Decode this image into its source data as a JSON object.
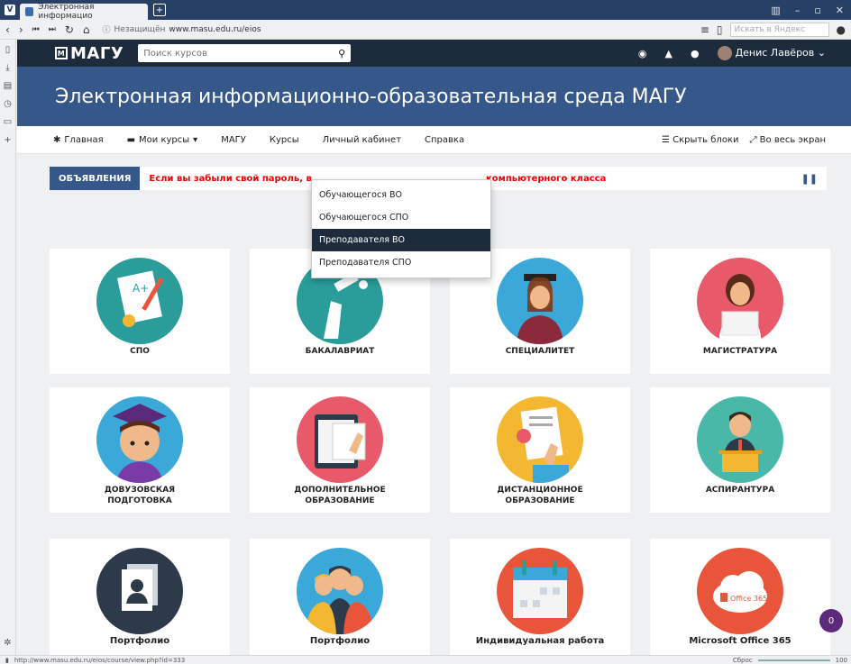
{
  "browser": {
    "tab_title": "Электронная информацио",
    "security_label": "Незащищён",
    "url": "www.masu.edu.ru/eios",
    "search_placeholder": "Искать в Яндекс",
    "status_url": "http://www.masu.edu.ru/eios/course/view.php?id=333",
    "reset_label": "Сброс",
    "zoom": "100"
  },
  "site": {
    "logo": "МАГУ",
    "search_placeholder": "Поиск курсов",
    "user_name": "Денис Лавёров",
    "hero_title": "Электронная информационно-образовательная среда МАГУ"
  },
  "menu": {
    "home": "Главная",
    "my_courses": "Мои курсы",
    "magu": "МАГУ",
    "courses": "Курсы",
    "cabinet": "Личный кабинет",
    "help": "Справка",
    "hide_blocks": "Скрыть блоки",
    "fullscreen": "Во весь экран"
  },
  "dropdown": {
    "items": [
      "Обучающегося ВО",
      "Обучающегося СПО",
      "Преподавателя ВО",
      "Преподавателя СПО"
    ],
    "active": "Преподавателя ВО"
  },
  "announce": {
    "label": "ОБЪЯВЛЕНИЯ",
    "text_left": "Если вы забыли свой пароль, в",
    "text_right": "компьютерного класса"
  },
  "cards": [
    {
      "line1": "СПО",
      "line2": "",
      "icon": "certificate-icon",
      "color": "#2a9d9a"
    },
    {
      "line1": "БАКАЛАВРИАТ",
      "line2": "",
      "icon": "graduation-hand-icon",
      "color": "#2a9d9a"
    },
    {
      "line1": "СПЕЦИАЛИТЕТ",
      "line2": "",
      "icon": "graduate-woman-icon",
      "color": "#2a9d9a"
    },
    {
      "line1": "МАГИСТРАТУРА",
      "line2": "",
      "icon": "laptop-woman-icon",
      "color": "#e85a6a"
    },
    {
      "line1": "ДОВУЗОВСКАЯ",
      "line2": "ПОДГОТОВКА",
      "icon": "student-boy-icon",
      "color": "#3aa8d8"
    },
    {
      "line1": "ДОПОЛНИТЕЛЬНОЕ",
      "line2": "ОБРАЗОВАНИЕ",
      "icon": "tablet-book-icon",
      "color": "#e85a6a"
    },
    {
      "line1": "ДИСТАНЦИОННОЕ",
      "line2": "ОБРАЗОВАНИЕ",
      "icon": "online-learning-icon",
      "color": "#f3b731"
    },
    {
      "line1": "АСПИРАНТУРА",
      "line2": "",
      "icon": "lecturer-icon",
      "color": "#4ab8a8"
    },
    {
      "line1": "Портфолио",
      "line2": "",
      "icon": "portfolio-document-icon",
      "color": "#2d3a4a"
    },
    {
      "line1": "Портфолио",
      "line2": "",
      "icon": "people-group-icon",
      "color": "#3aa8d8"
    },
    {
      "line1": "Индивидуальная работа",
      "line2": "",
      "icon": "calendar-icon",
      "color": "#e8553a"
    },
    {
      "line1": "Microsoft Office 365",
      "line2": "",
      "icon": "office365-icon",
      "color": "#e8553a"
    }
  ],
  "office_label": "Office 365",
  "notification_count": "0"
}
